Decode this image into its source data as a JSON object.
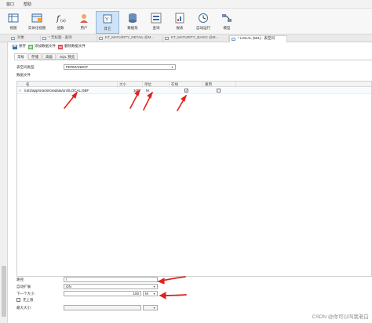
{
  "menu": [
    "窗口",
    "帮助"
  ],
  "toolbar": [
    {
      "label": "视图",
      "icon": "table-icon"
    },
    {
      "label": "实体化视图",
      "icon": "materialized-view-icon"
    },
    {
      "label": "函数",
      "icon": "function-icon"
    },
    {
      "label": "用户",
      "icon": "user-icon"
    },
    {
      "label": "其它",
      "icon": "other-icon"
    },
    {
      "label": "数据泵",
      "icon": "data-pump-icon"
    },
    {
      "label": "查询",
      "icon": "query-icon"
    },
    {
      "label": "报表",
      "icon": "report-icon"
    },
    {
      "label": "自动运行",
      "icon": "schedule-icon"
    },
    {
      "label": "模型",
      "icon": "model-icon"
    }
  ],
  "tabs": [
    "对象",
    "* 无标题 - 查询",
    "KT_MATURITY_DETAIL @M...",
    "KT_MATURITY_BASIC @M...",
    "* LOCAL (601) - 表空间"
  ],
  "actions": {
    "save": "保存",
    "add_datafile": "添加数据文件",
    "delete_datafile": "删除数据文件"
  },
  "subtabs": [
    "常规",
    "存储",
    "高级",
    "SQL 预览"
  ],
  "general": {
    "tablespace_type_label": "表空间类型:",
    "tablespace_type_value": "PERMANENT",
    "datafile_section_label": "数据文件"
  },
  "grid": {
    "columns": [
      "名",
      "大小",
      "单位",
      "在线",
      "重用"
    ],
    "rows": [
      {
        "name": "/u01/app/oracle/oradata/orcl/LOCAL.DBF",
        "size": "100",
        "unit": "M",
        "online": true,
        "reuse": false
      }
    ]
  },
  "properties": {
    "path_label": "路径:",
    "path_value": "\\",
    "autoextend_label": "自动扩展:",
    "autoextend_value": "ON",
    "next_size_label": "下一个大小:",
    "next_size_value": "100",
    "next_size_unit": "M",
    "unlimited_label": "无上限",
    "max_size_label": "最大大小:"
  },
  "watermark": "CSDN @你可以叫我老白",
  "colors": {
    "arrow": "#e3211c",
    "active_tool": "#cfe3f7"
  }
}
